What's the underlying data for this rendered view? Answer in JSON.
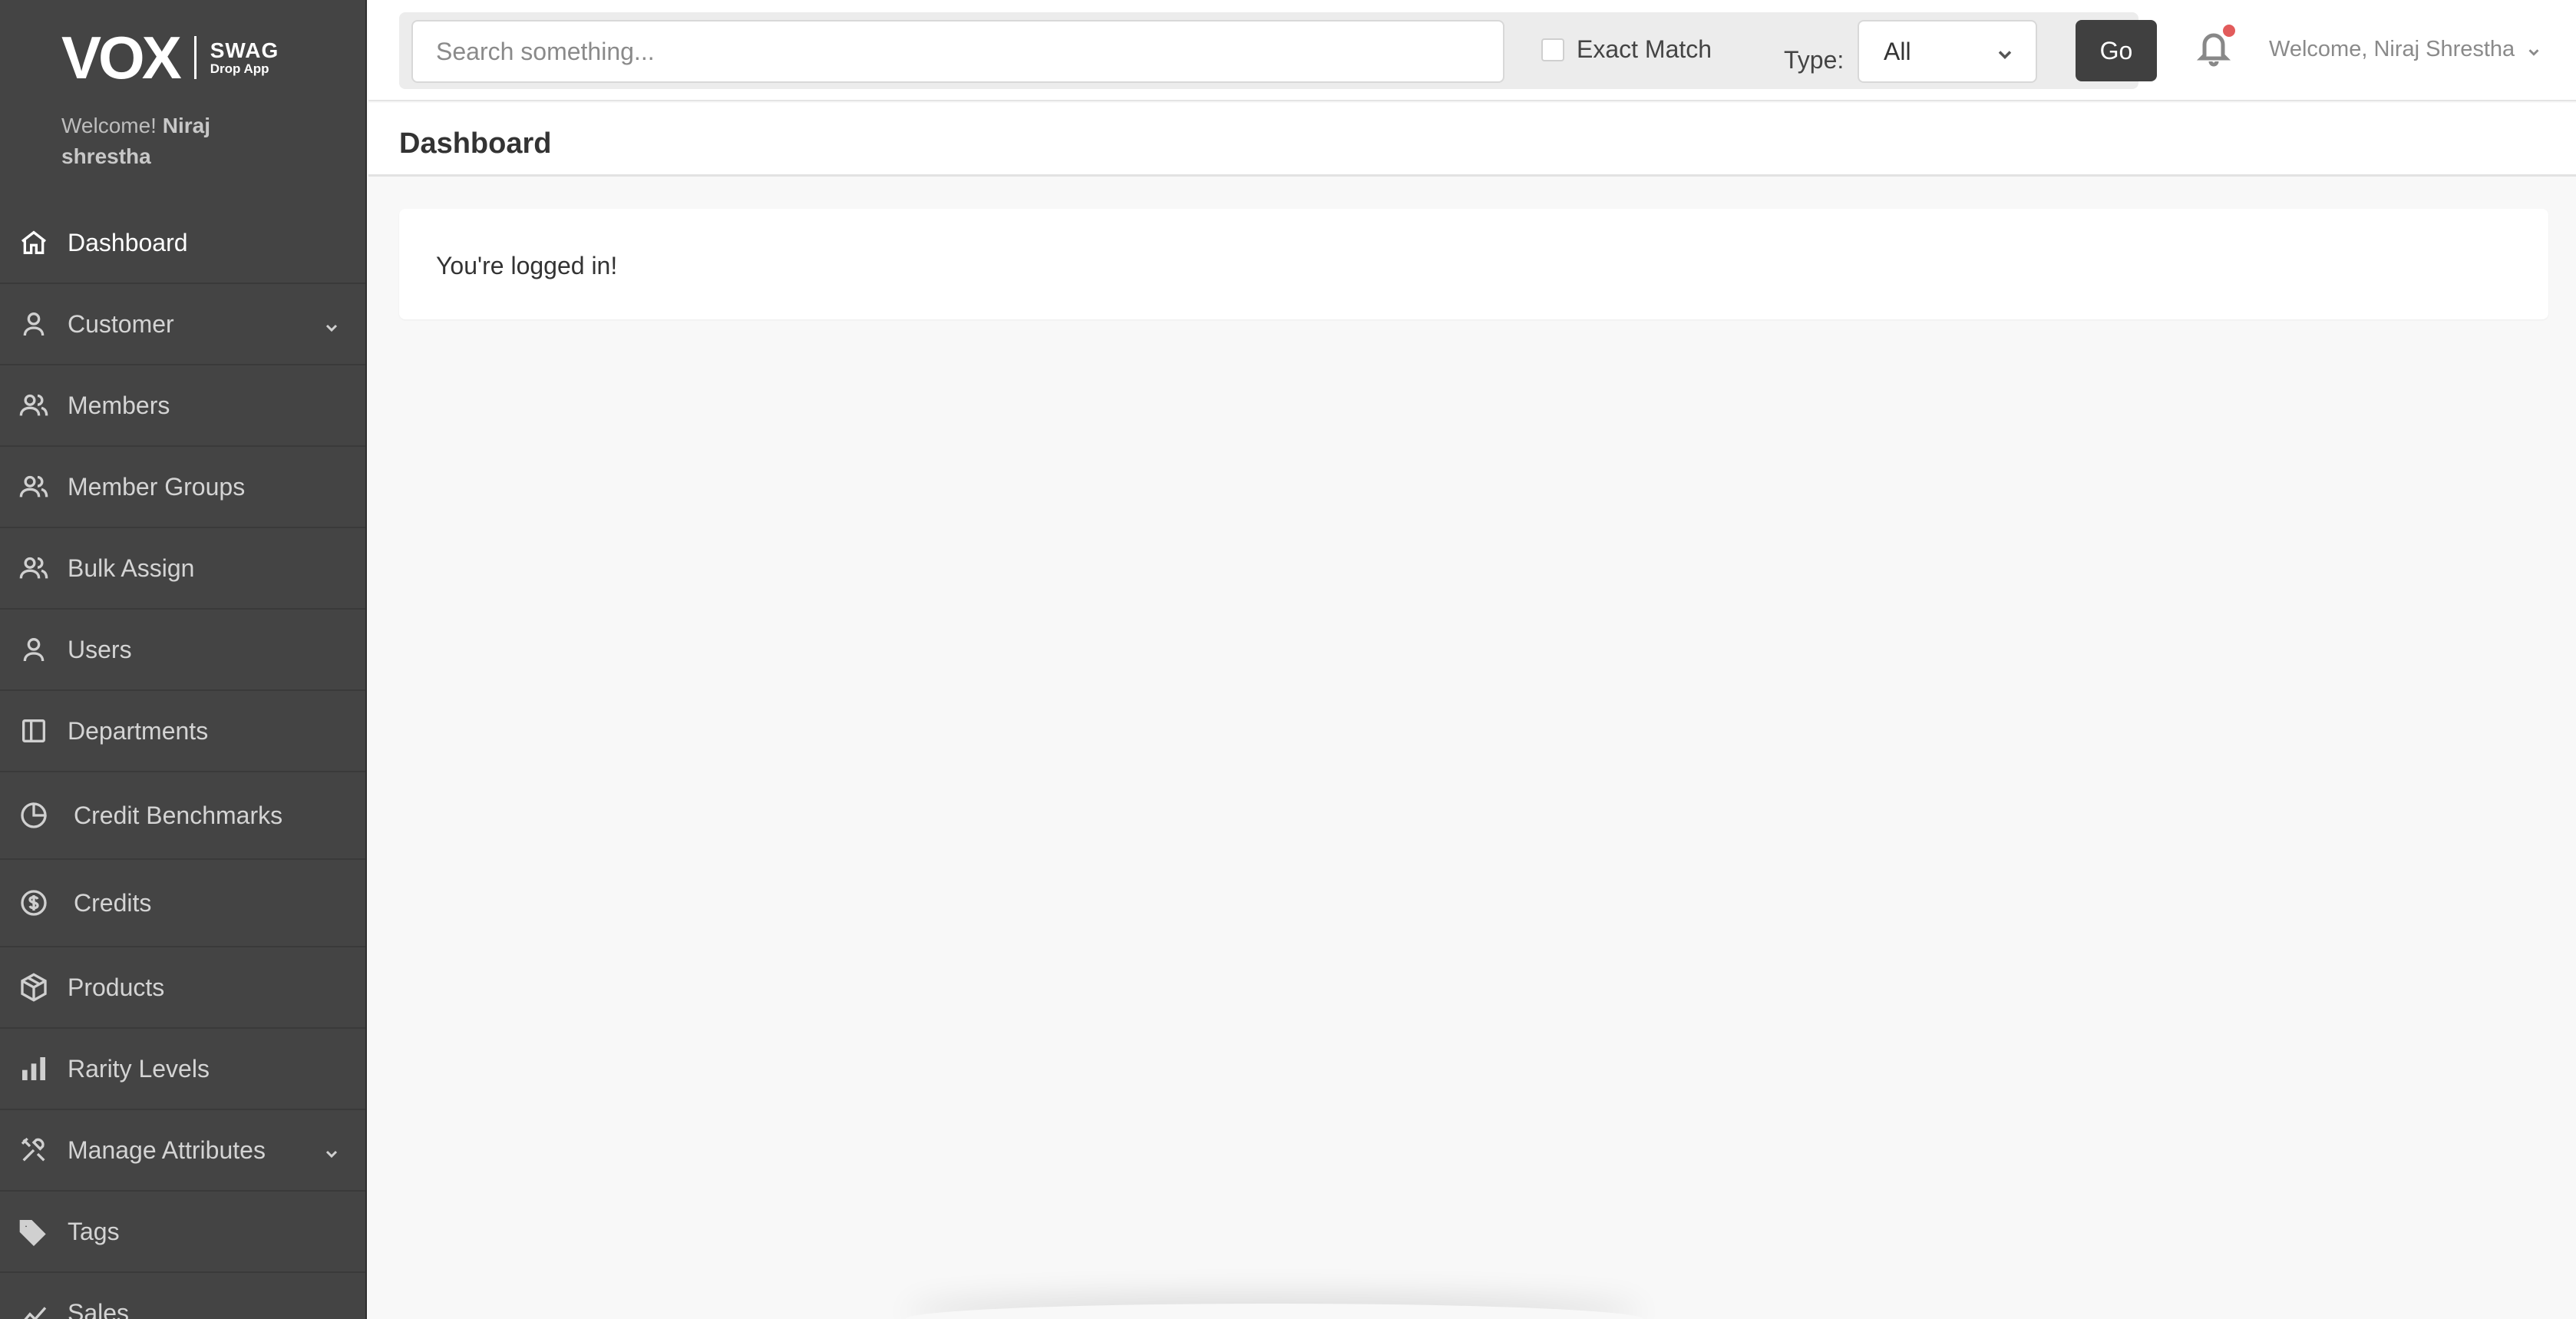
{
  "brand": {
    "name": "VOX",
    "sub_top": "SWAG",
    "sub_bottom": "Drop App"
  },
  "sidebar": {
    "welcome_prefix": "Welcome!",
    "welcome_name": "Niraj shrestha",
    "items": [
      {
        "label": "Dashboard",
        "icon": "home-icon",
        "active": true
      },
      {
        "label": "Customer",
        "icon": "user-icon",
        "expandable": true
      },
      {
        "label": "Members",
        "icon": "users-icon"
      },
      {
        "label": "Member Groups",
        "icon": "users-icon"
      },
      {
        "label": "Bulk Assign",
        "icon": "users-icon"
      },
      {
        "label": "Users",
        "icon": "user-icon"
      },
      {
        "label": "Departments",
        "icon": "columns-icon"
      },
      {
        "label": "Credit Benchmarks",
        "icon": "pie-chart-icon"
      },
      {
        "label": "Credits",
        "icon": "dollar-circle-icon"
      },
      {
        "label": "Products",
        "icon": "cube-icon"
      },
      {
        "label": "Rarity Levels",
        "icon": "bar-chart-icon"
      },
      {
        "label": "Manage Attributes",
        "icon": "tools-icon",
        "expandable": true
      },
      {
        "label": "Tags",
        "icon": "tags-icon"
      },
      {
        "label": "Sales",
        "icon": "trend-icon"
      }
    ]
  },
  "search": {
    "placeholder": "Search something...",
    "exact_match_label": "Exact Match",
    "type_label": "Type:",
    "type_value": "All",
    "go_label": "Go"
  },
  "header": {
    "user_welcome": "Welcome, Niraj Shrestha",
    "notification_color": "#e25b5b"
  },
  "page": {
    "title": "Dashboard",
    "message": "You're logged in!"
  }
}
